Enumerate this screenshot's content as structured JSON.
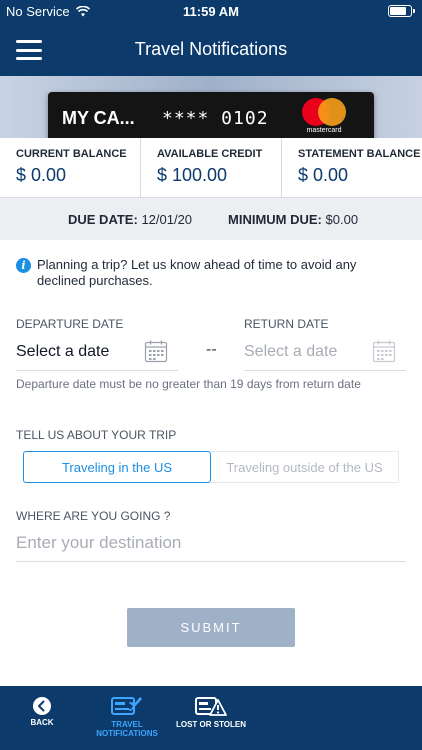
{
  "status_bar": {
    "carrier": "No Service",
    "time": "11:59 AM",
    "battery_level": 0.85
  },
  "nav": {
    "title": "Travel Notifications"
  },
  "card": {
    "name": "MY CA...",
    "masked_number": "**** 0102",
    "network": "mastercard"
  },
  "balances": [
    {
      "label": "CURRENT BALANCE",
      "value": "$ 0.00"
    },
    {
      "label": "AVAILABLE CREDIT",
      "value": "$ 100.00"
    },
    {
      "label": "STATEMENT BALANCE",
      "value": "$ 0.00"
    }
  ],
  "due": {
    "date_label": "DUE DATE:",
    "date_value": "12/01/20",
    "minimum_label": "MINIMUM DUE:",
    "minimum_value": "$0.00"
  },
  "info": {
    "text": "Planning a trip? Let us know ahead of time to avoid any declined purchases."
  },
  "departure": {
    "label": "DEPARTURE DATE",
    "value": "Select a date"
  },
  "separator": "--",
  "return_date": {
    "label": "RETURN DATE",
    "placeholder": "Select a date"
  },
  "date_help": "Departure date must be no greater than 19 days from return date",
  "trip": {
    "label": "TELL US ABOUT YOUR TRIP",
    "options": [
      {
        "label": "Traveling in the US",
        "selected": true
      },
      {
        "label": "Traveling outside of the US",
        "selected": false
      }
    ]
  },
  "destination": {
    "label": "WHERE ARE YOU GOING ?",
    "placeholder": "Enter your destination"
  },
  "submit_label": "SUBMIT",
  "tabs": [
    {
      "label": "BACK",
      "icon": "back-arrow-icon"
    },
    {
      "label_line1": "TRAVEL",
      "label_line2": "NOTIFICATIONS",
      "icon": "travel-card-plane-icon",
      "active": true
    },
    {
      "label": "LOST OR STOLEN",
      "icon": "card-warning-icon"
    }
  ],
  "colors": {
    "primary": "#0b3a6b",
    "accent": "#1a8fe3",
    "active_tab": "#3ea6ff",
    "submit_disabled": "#9eb1c6"
  }
}
